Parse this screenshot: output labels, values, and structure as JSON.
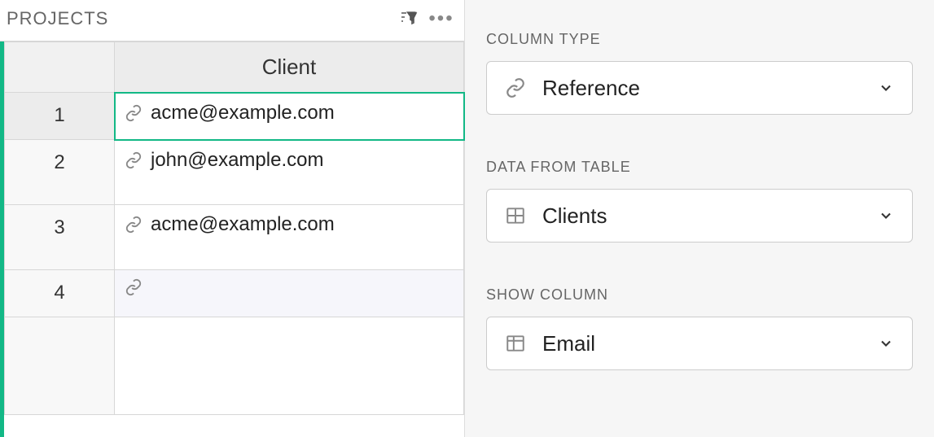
{
  "left": {
    "title": "PROJECTS",
    "column_header": "Client",
    "rows": [
      {
        "num": "1",
        "value": "acme@example.com"
      },
      {
        "num": "2",
        "value": "john@example.com"
      },
      {
        "num": "3",
        "value": "acme@example.com"
      },
      {
        "num": "4",
        "value": ""
      }
    ]
  },
  "right": {
    "sections": [
      {
        "label": "COLUMN TYPE",
        "value": "Reference"
      },
      {
        "label": "DATA FROM TABLE",
        "value": "Clients"
      },
      {
        "label": "SHOW COLUMN",
        "value": "Email"
      }
    ]
  }
}
